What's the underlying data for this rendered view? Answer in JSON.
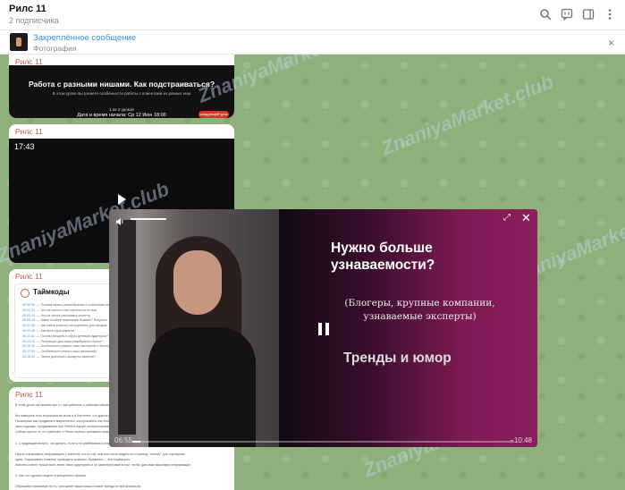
{
  "header": {
    "title": "Рилс 11",
    "subtitle": "2 подписчика",
    "icons": [
      "search-icon",
      "comments-icon",
      "sidebar-icon",
      "more-icon"
    ]
  },
  "pinned": {
    "title": "Закреплённое сообщение",
    "subtitle": "Фотография",
    "close_icon": "×"
  },
  "messages": {
    "m1": {
      "author": "Рилс 11",
      "banner_title": "Работа с разными нишами. Как подстраиваться?",
      "banner_sub": "В этом уроке вы узнаете особенности работы с клиентами из разных ниш",
      "banner_part": "1 из 2 уроков",
      "banner_date": "Дата и время начала: Ср 12 Июн 18:00",
      "banner_btn": "следующий урок"
    },
    "m2": {
      "author": "Рилс 11",
      "video_time": "17:43"
    },
    "m3": {
      "author": "Рилс 11",
      "card_title": "Таймкоды",
      "rows": [
        {
          "t": "00:00:00",
          "s": "Почему важно разнообразить с клиентами разных ниш"
        },
        {
          "t": "00:01:24",
          "s": "Что из опыта стоит перенести из ниш"
        },
        {
          "t": "00:03:10",
          "s": "Что из опыта рассказать клиенту"
        },
        {
          "t": "00:05:18",
          "s": "Какие особые пожелания бывают? Вопросы"
        },
        {
          "t": "00:07:26",
          "s": "Как найти клиенту инструменты для продаж"
        },
        {
          "t": "00:09:40",
          "s": "Как вести для клиента"
        },
        {
          "t": "00:11:02",
          "s": "Почему входить в образ целевой аудитории?"
        },
        {
          "t": "00:13:15",
          "s": "Репозиции для ниши разобраться более?"
        },
        {
          "t": "00:15:30",
          "s": "Особенности разных ниш (экспертов и блогеров)"
        },
        {
          "t": "00:17:05",
          "s": "Особенности разных ниш (компаний)"
        },
        {
          "t": "00:18:40",
          "s": "Зачем дополнять аккаунты заметки?"
        }
      ]
    },
    "m4": {
      "author": "Рилс 11",
      "lines": [
        "В этом уроке поговорим про то, как работать с разными нишами",
        "",
        "Вы наверное есть встречали во всем и в Контенте, и в других нишах",
        "Посмотрим как продвигать маркетолога, консультанта или блогера, у каждого",
        "свои подходы, продвижение про Reels в сфере консультирования",
        "Сейчас ценны те, кто работает с Reels глубоко понимают нишу",
        "",
        "1. Следующий вопрос: что делать, если я не разбираюсь в нише?",
        "",
        "Нужно спрашивать информацию у клиента: кто их ЦА, кем они хотят видеть их страницу, \"кнопку\" для сценариев,",
        "идеи. Опрашивать клиента, проводить созвоны, брифинги — это нормально.",
        "Именно клиент лучше всех знает свою аудиторию и он заинтересован в том, чтобы дать вам максимум информации.",
        "",
        "2. Как что сделать акцент в конкретных сферах",
        "",
        "Обращайте внимание на то, чем живёт ваша ниша и какие тренды в ней актуальны"
      ]
    }
  },
  "player": {
    "headline": "Нужно больше узнаваемости?",
    "subline": "(Блогеры, крупные компании, узнаваемые эксперты)",
    "trends": "Тренды и юмор",
    "time_current": "06:55",
    "time_remaining": "−10:48",
    "progress": 0.02,
    "volume": 1.0,
    "expand_icon": "⤢",
    "close_icon": "✕"
  },
  "watermark": "ZnaniyaMarket.club"
}
